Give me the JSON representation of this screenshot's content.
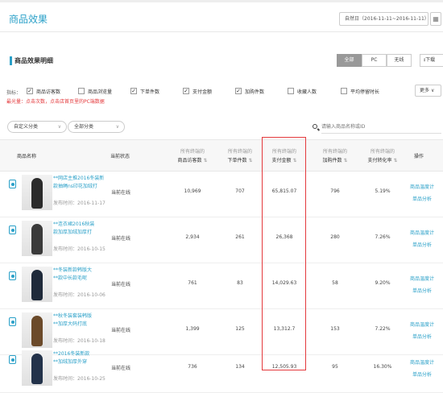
{
  "page": {
    "title": "商品效果",
    "date_range": "自然日（2016-11-11~2016-11-11）"
  },
  "section": {
    "title": "商品效果明细"
  },
  "device_tabs": [
    "全部",
    "PC",
    "无线"
  ],
  "download_label": "下载",
  "metrics": {
    "label": "指标：",
    "items": [
      {
        "label": "商品访客数",
        "checked": true
      },
      {
        "label": "商品浏览量",
        "checked": false
      },
      {
        "label": "下单件数",
        "checked": true
      },
      {
        "label": "支付金额",
        "checked": true
      },
      {
        "label": "加购件数",
        "checked": true
      },
      {
        "label": "收藏人数",
        "checked": false
      },
      {
        "label": "平均停留时长",
        "checked": false
      }
    ],
    "more_label": "更多",
    "hint": "最光量：点击次数，点击店首页里的PC端数据"
  },
  "filters": {
    "category": "自定义分类",
    "all_categories": "全部分类",
    "search_placeholder": "请输入商品名称或ID"
  },
  "table": {
    "headers": {
      "name": "商品名称",
      "status": "当前状态",
      "visitors": {
        "top": "所有终端的",
        "bottom": "商品访客数"
      },
      "orders": {
        "top": "所有终端的",
        "bottom": "下单件数"
      },
      "payment": {
        "top": "所有终端的",
        "bottom": "支付金额"
      },
      "cart": {
        "top": "所有终端的",
        "bottom": "加购件数"
      },
      "conversion": {
        "top": "所有终端的",
        "bottom": "支付转化率"
      },
      "ops": "操作"
    },
    "rows": [
      {
        "name1": "**网店主推2016冬装新",
        "name2": "款抽绳ns印花加绒打",
        "time": "发布时间：2016-11-17",
        "status": "当前在线",
        "visitors": "10,969",
        "orders": "707",
        "payment": "65,815.07",
        "cart": "796",
        "conversion": "5.19%",
        "op1": "商品温度计",
        "op2": "单品分析",
        "thumb_color": "#2b2b2b"
      },
      {
        "name1": "**连衣裙2016秋装",
        "name2": "款加厚加绒加厚打",
        "time": "发布时间：2016-10-15",
        "status": "当前在线",
        "visitors": "2,934",
        "orders": "261",
        "payment": "26,368",
        "cart": "280",
        "conversion": "7.26%",
        "op1": "商品温度计",
        "op2": "单品分析",
        "thumb_color": "#3a3a3a"
      },
      {
        "name1": "**冬装新款韩版大",
        "name2": "**款中长款毛呢",
        "time": "发布时间：2016-10-06",
        "status": "当前在线",
        "visitors": "761",
        "orders": "83",
        "payment": "14,029.63",
        "cart": "58",
        "conversion": "9.20%",
        "op1": "商品温度计",
        "op2": "单品分析",
        "thumb_color": "#1f2a3a"
      },
      {
        "name1": "**秋冬装套装韩版",
        "name2": "**加厚大码打底",
        "time": "发布时间：2016-10-18",
        "status": "当前在线",
        "visitors": "1,399",
        "orders": "125",
        "payment": "13,312.7",
        "cart": "153",
        "conversion": "7.22%",
        "op1": "商品温度计",
        "op2": "单品分析",
        "thumb_color": "#6b4a2a"
      },
      {
        "name1": "**2016冬装新款",
        "name2": "**加绒加厚外穿",
        "time": "发布时间：2016-10-25",
        "status": "当前在线",
        "visitors": "736",
        "orders": "134",
        "payment": "12,505.93",
        "cart": "95",
        "conversion": "16.30%",
        "op1": "商品温度计",
        "op2": "单品分析",
        "thumb_color": "#23324a"
      }
    ]
  },
  "icons": {
    "calendar": "calendar-icon",
    "search": "search-icon",
    "product": "product-icon",
    "sort": "sort-icon"
  },
  "colors": {
    "accent": "#2aa0c8",
    "highlight": "#e4393c",
    "active_tab": "#999999"
  }
}
